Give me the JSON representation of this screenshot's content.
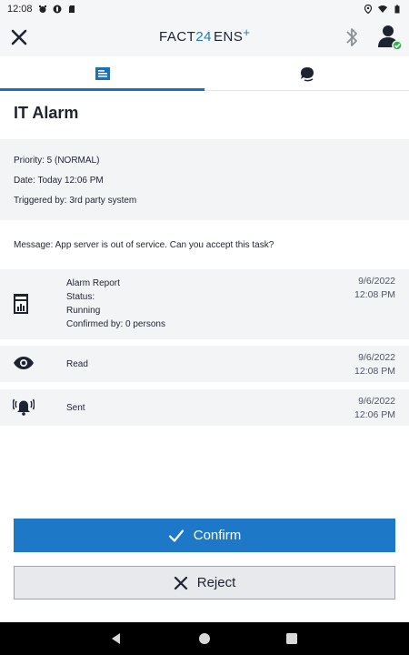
{
  "status_bar": {
    "time": "12:08"
  },
  "app": {
    "logo_main": "FACT",
    "logo_num": "24",
    "logo_suffix": "ENS",
    "logo_plus": "+"
  },
  "tabs": [
    {
      "icon": "document-icon",
      "active": true
    },
    {
      "icon": "chat-icon",
      "active": false
    }
  ],
  "alarm": {
    "title": "IT Alarm",
    "priority": "Priority: 5 (NORMAL)",
    "date": "Date: Today 12:06 PM",
    "triggered_by": "Triggered by: 3rd party system",
    "message": "Message: App server is out of service. Can you accept this task?"
  },
  "history": [
    {
      "icon": "report-icon",
      "title": "Alarm Report",
      "status_label": "Status:",
      "status_value": "Running",
      "confirmed": "Confirmed by: 0 persons",
      "date": "9/6/2022",
      "time": "12:08 PM"
    },
    {
      "icon": "eye-icon",
      "label": "Read",
      "date": "9/6/2022",
      "time": "12:08 PM"
    },
    {
      "icon": "alarm-bell-icon",
      "label": "Sent",
      "date": "9/6/2022",
      "time": "12:06 PM"
    }
  ],
  "actions": {
    "confirm_label": "Confirm",
    "reject_label": "Reject"
  },
  "colors": {
    "accent": "#1d78c8",
    "panel": "#f3f4f6",
    "success": "#2db34a"
  }
}
